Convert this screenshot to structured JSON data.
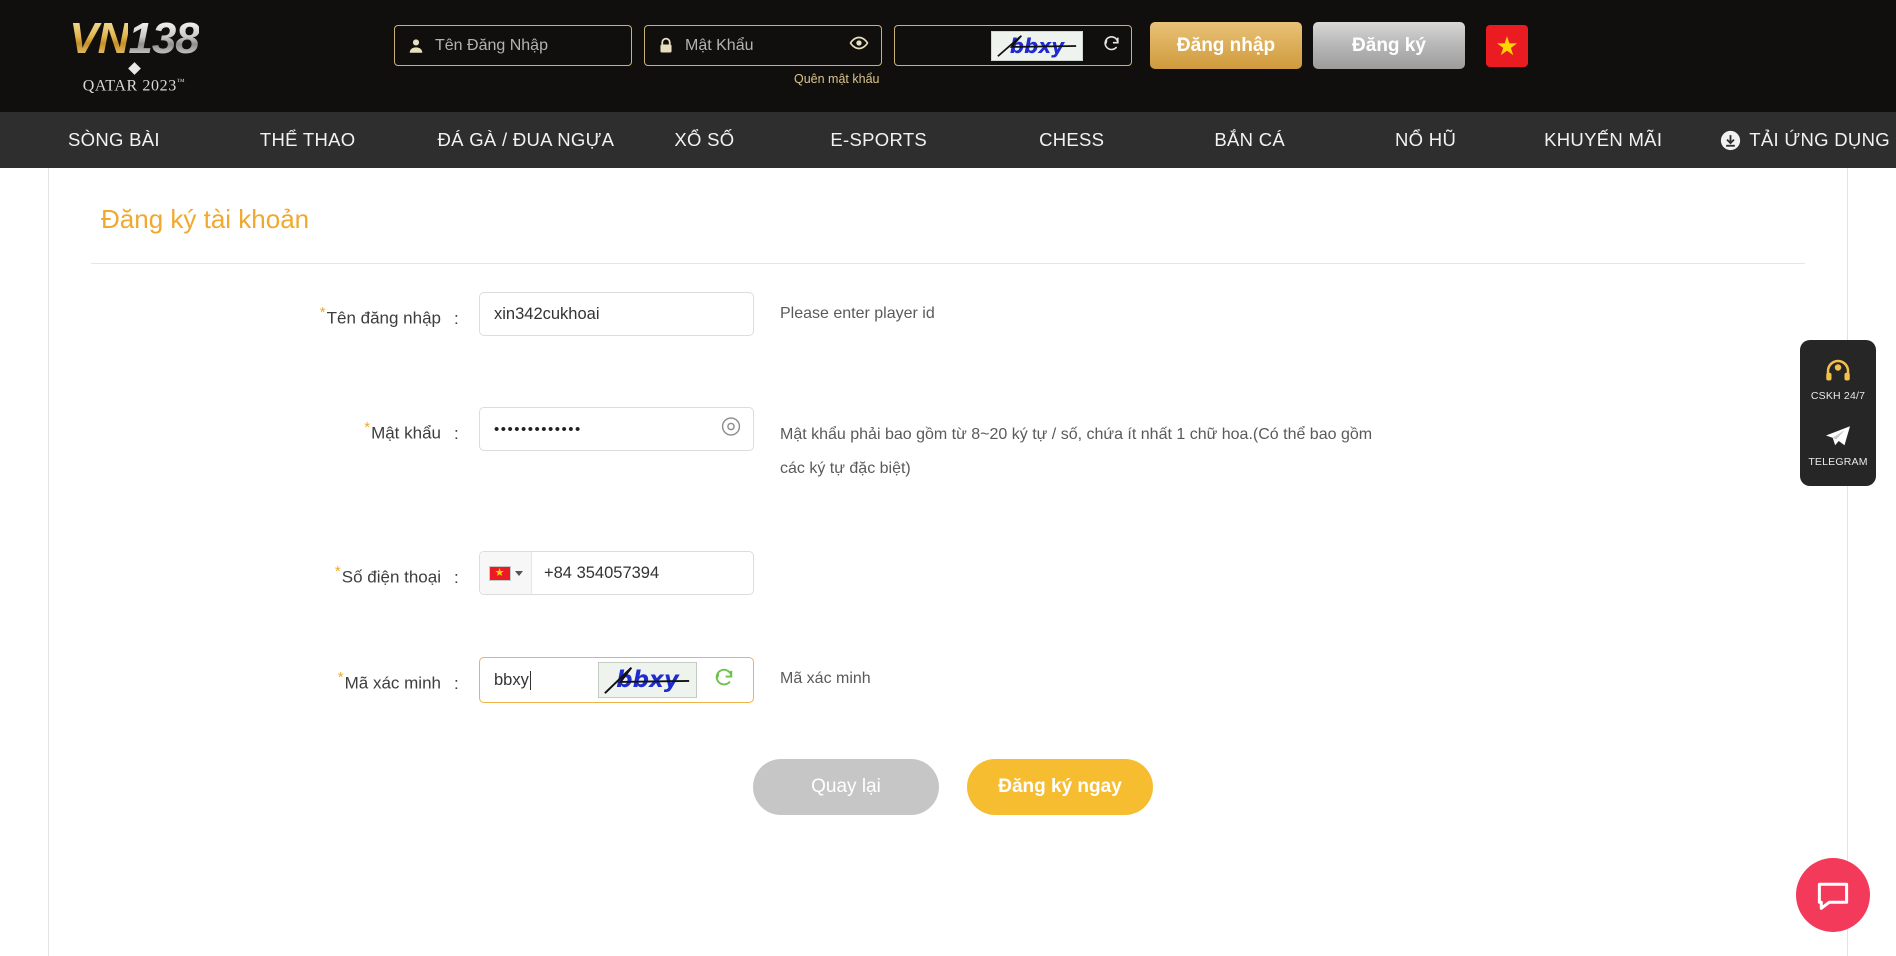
{
  "header": {
    "logo": {
      "brand_first": "VN",
      "brand_second": "138",
      "tagline": "QATAR 2023",
      "tm": "™"
    },
    "username_placeholder": "Tên Đăng Nhập",
    "password_placeholder": "Mật Khẩu",
    "captcha_text": "bbxy",
    "forgot_password": "Quên mật khẩu",
    "login_button": "Đăng nhập",
    "register_button": "Đăng ký",
    "language_flag": "vietnam-flag",
    "colors": {
      "gold": "#cf9a3c",
      "cream_border": "#c8b279",
      "flag_red": "#ea1c21",
      "star_yellow": "#ffd700"
    }
  },
  "nav": {
    "items": [
      {
        "label": "SÒNG BÀI"
      },
      {
        "label": "THỂ THAO"
      },
      {
        "label": "ĐÁ GÀ / ĐUA NGỰA"
      },
      {
        "label": "XỔ SỐ"
      },
      {
        "label": "E-SPORTS"
      },
      {
        "label": "CHESS"
      },
      {
        "label": "BẮN CÁ"
      },
      {
        "label": "NỔ HŨ"
      },
      {
        "label": "KHUYẾN MÃI"
      },
      {
        "label": "TẢI ỨNG DỤNG",
        "icon": "download-icon"
      }
    ]
  },
  "main": {
    "title": "Đăng ký tài khoản",
    "fields": {
      "username": {
        "label": "Tên đăng nhập",
        "colon": ":",
        "value": "xin342cukhoai",
        "hint": "Please enter player id",
        "required": "*"
      },
      "password": {
        "label": "Mật khẩu",
        "colon": ":",
        "value": "•••••••••••••",
        "hint": "Mật khẩu phải bao gồm từ 8~20 ký tự / số, chứa ít nhất 1 chữ hoa.(Có thể bao gồm các ký tự đặc biệt)",
        "required": "*",
        "toggle_icon": "eye-icon"
      },
      "phone": {
        "label": "Số điện thoại",
        "colon": ":",
        "country_flag": "vietnam-flag",
        "value": "+84 354057394",
        "required": "*"
      },
      "verify": {
        "label": "Mã xác minh",
        "colon": ":",
        "value": "bbxy",
        "captcha_text": "bbxy",
        "hint": "Mã xác minh",
        "required": "*",
        "refresh_icon": "refresh-icon"
      }
    },
    "buttons": {
      "back": "Quay lại",
      "submit": "Đăng ký ngay"
    },
    "colors": {
      "title_gold": "#f0a92e",
      "submit_yellow": "#f7bd31",
      "back_gray": "#c6c6c6",
      "focus_border": "#f0b34a"
    }
  },
  "side_panel": {
    "items": [
      {
        "label": "CSKH 24/7",
        "icon": "headset-icon"
      },
      {
        "label": "TELEGRAM",
        "icon": "telegram-icon"
      }
    ]
  },
  "chat_widget": {
    "icon": "chat-bubble-icon",
    "color": "#f43a5a"
  }
}
